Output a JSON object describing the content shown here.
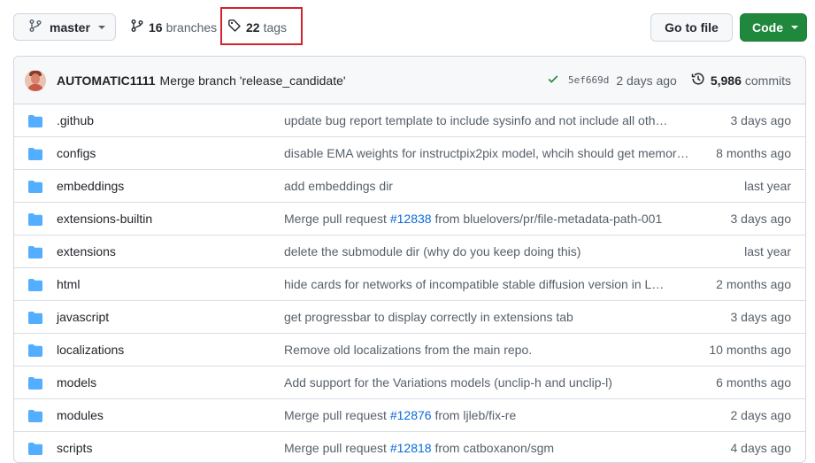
{
  "toolbar": {
    "branch": "master",
    "branches_count": "16",
    "branches_label": "branches",
    "tags_count": "22",
    "tags_label": "tags",
    "goto_file": "Go to file",
    "code": "Code"
  },
  "latest_commit": {
    "author": "AUTOMATIC1111",
    "message": "Merge branch 'release_candidate'",
    "sha": "5ef669d",
    "time": "2 days ago",
    "commits_count": "5,986",
    "commits_label": "commits"
  },
  "colors": {
    "folder": "#54aeff",
    "code_button": "#1f883d",
    "highlight": "#d1242f",
    "link": "#0969da"
  },
  "files": [
    {
      "name": ".github",
      "msg_pre": "update bug report template to include sysinfo and not include all oth…",
      "pr": "",
      "msg_post": "",
      "time": "3 days ago"
    },
    {
      "name": "configs",
      "msg_pre": "disable EMA weights for instructpix2pix model, whcih should get memor…",
      "pr": "",
      "msg_post": "",
      "time": "8 months ago"
    },
    {
      "name": "embeddings",
      "msg_pre": "add embeddings dir",
      "pr": "",
      "msg_post": "",
      "time": "last year"
    },
    {
      "name": "extensions-builtin",
      "msg_pre": "Merge pull request ",
      "pr": "#12838",
      "msg_post": " from bluelovers/pr/file-metadata-path-001",
      "time": "3 days ago"
    },
    {
      "name": "extensions",
      "msg_pre": "delete the submodule dir (why do you keep doing this)",
      "pr": "",
      "msg_post": "",
      "time": "last year"
    },
    {
      "name": "html",
      "msg_pre": "hide cards for networks of incompatible stable diffusion version in L…",
      "pr": "",
      "msg_post": "",
      "time": "2 months ago"
    },
    {
      "name": "javascript",
      "msg_pre": "get progressbar to display correctly in extensions tab",
      "pr": "",
      "msg_post": "",
      "time": "3 days ago"
    },
    {
      "name": "localizations",
      "msg_pre": "Remove old localizations from the main repo.",
      "pr": "",
      "msg_post": "",
      "time": "10 months ago"
    },
    {
      "name": "models",
      "msg_pre": "Add support for the Variations models (unclip-h and unclip-l)",
      "pr": "",
      "msg_post": "",
      "time": "6 months ago"
    },
    {
      "name": "modules",
      "msg_pre": "Merge pull request ",
      "pr": "#12876",
      "msg_post": " from ljleb/fix-re",
      "time": "2 days ago"
    },
    {
      "name": "scripts",
      "msg_pre": "Merge pull request ",
      "pr": "#12818",
      "msg_post": " from catboxanon/sgm",
      "time": "4 days ago"
    }
  ]
}
